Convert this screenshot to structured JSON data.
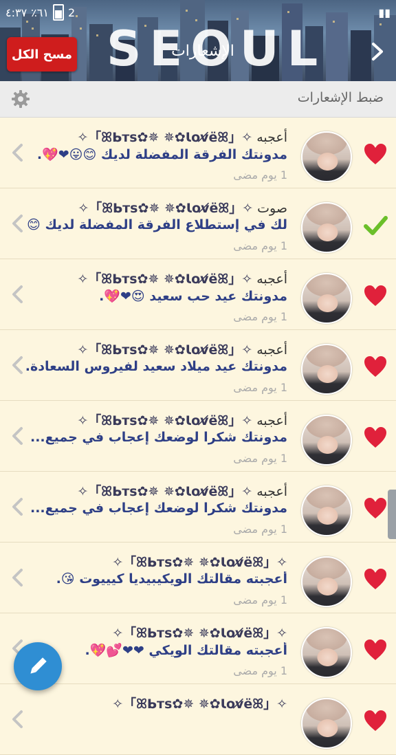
{
  "status_bar": {
    "left_text": "٤:٣٧",
    "battery_percent": "٪٦١",
    "signal": "2"
  },
  "header": {
    "banner_text": "SEOUL",
    "title": "الإشعارات",
    "clear_all_label": "مسح الكل"
  },
  "settings": {
    "label": "ضبط الإشعارات"
  },
  "notifications": [
    {
      "type": "like",
      "action": "أعجبه",
      "user": "✧「ꕤᖯᴛꜱ✿✵ ✵✿Ꙇoᴠ̸ëꕤ」✧",
      "message": "مدونتك الفرقة المفضلة لديك 😊😛❤💖.",
      "time": "1 يوم مضى"
    },
    {
      "type": "vote",
      "action": "صوت",
      "user": "✧「ꕤᖯᴛꜱ✿✵ ✵✿Ꙇoᴠ̸ëꕤ」✧",
      "message": "لك في إستطلاع الفرقة المفضلة لديك 😊...",
      "time": "1 يوم مضى"
    },
    {
      "type": "like",
      "action": "أعجبه",
      "user": "✧「ꕤᖯᴛꜱ✿✵ ✵✿Ꙇoᴠ̸ëꕤ」✧",
      "message": "مدونتك عيد حب سعيد 😍❤💖.",
      "time": "1 يوم مضى"
    },
    {
      "type": "like",
      "action": "أعجبه",
      "user": "✧「ꕤᖯᴛꜱ✿✵ ✵✿Ꙇoᴠ̸ëꕤ」✧",
      "message": "مدونتك عيد ميلاد سعيد لفيروس السعادة...",
      "time": "1 يوم مضى"
    },
    {
      "type": "like",
      "action": "أعجبه",
      "user": "✧「ꕤᖯᴛꜱ✿✵ ✵✿Ꙇoᴠ̸ëꕤ」✧",
      "message": "مدونتك شكرا لوضعك إعجاب في جميع...",
      "time": "1 يوم مضى"
    },
    {
      "type": "like",
      "action": "أعجبه",
      "user": "✧「ꕤᖯᴛꜱ✿✵ ✵✿Ꙇoᴠ̸ëꕤ」✧",
      "message": "مدونتك شكرا لوضعك إعجاب في جميع...",
      "time": "1 يوم مضى"
    },
    {
      "type": "like",
      "action": "",
      "user": "✧「ꕤᖯᴛꜱ✿✵ ✵✿Ꙇoᴠ̸ëꕤ」✧",
      "message": "أعجبته مقالتك الويكيبيديا كيييوت 😘.",
      "time": "1 يوم مضى"
    },
    {
      "type": "like",
      "action": "",
      "user": "✧「ꕤᖯᴛꜱ✿✵ ✵✿Ꙇoᴠ̸ëꕤ」✧",
      "message": "أعجبته مقالتك الويكي ❤❤💕💖.",
      "time": "1 يوم مضى"
    },
    {
      "type": "like",
      "action": "",
      "user": "✧「ꕤᖯᴛꜱ✿✵ ✵✿Ꙇoᴠ̸ëꕤ」✧",
      "message": "",
      "time": ""
    }
  ],
  "colors": {
    "like": "#e0213b",
    "vote": "#6bbf2a",
    "accent": "#cf1d1d",
    "fab": "#2f8ed3"
  },
  "icons": {
    "like": "heart-icon",
    "vote": "checkmark-icon",
    "fab": "pencil-icon",
    "settings": "gear-icon",
    "back": "back-arrow-icon"
  }
}
